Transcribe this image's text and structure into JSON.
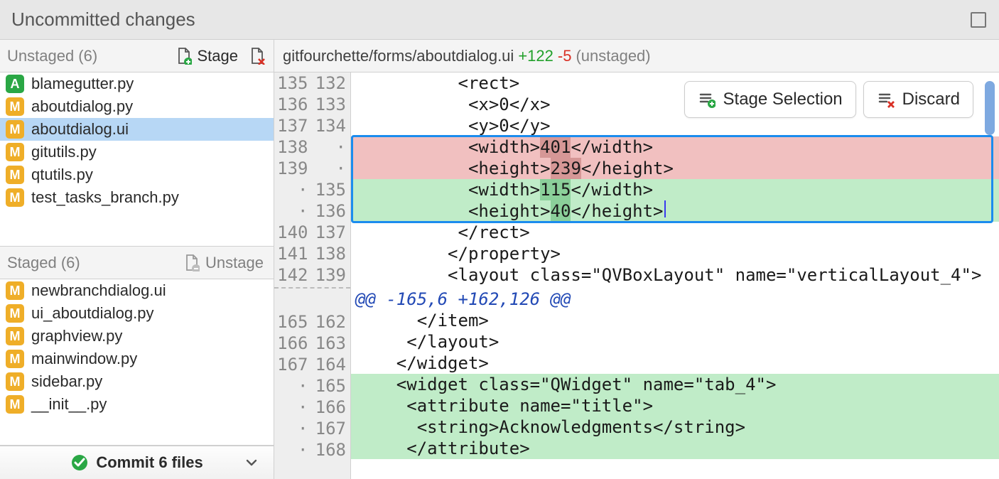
{
  "header": {
    "title": "Uncommitted changes"
  },
  "sidebar": {
    "unstaged": {
      "title": "Unstaged (6)",
      "stage_label": "Stage",
      "items": [
        {
          "status": "A",
          "name": "blamegutter.py",
          "selected": false
        },
        {
          "status": "M",
          "name": "aboutdialog.py",
          "selected": false
        },
        {
          "status": "M",
          "name": "aboutdialog.ui",
          "selected": true
        },
        {
          "status": "M",
          "name": "gitutils.py",
          "selected": false
        },
        {
          "status": "M",
          "name": "qtutils.py",
          "selected": false
        },
        {
          "status": "M",
          "name": "test_tasks_branch.py",
          "selected": false
        }
      ]
    },
    "staged": {
      "title": "Staged (6)",
      "unstage_label": "Unstage",
      "items": [
        {
          "status": "M",
          "name": "newbranchdialog.ui"
        },
        {
          "status": "M",
          "name": "ui_aboutdialog.py"
        },
        {
          "status": "M",
          "name": "graphview.py"
        },
        {
          "status": "M",
          "name": "mainwindow.py"
        },
        {
          "status": "M",
          "name": "sidebar.py"
        },
        {
          "status": "M",
          "name": "__init__.py"
        }
      ]
    },
    "commit_label": "Commit 6 files"
  },
  "diff": {
    "path": "gitfourchette/forms/aboutdialog.ui",
    "additions": "+122",
    "deletions": "-5",
    "state": "(unstaged)",
    "actions": {
      "stage_selection": "Stage Selection",
      "discard": "Discard"
    },
    "lines": [
      {
        "old": "135",
        "new": "132",
        "type": "ctx",
        "text": "          <rect>"
      },
      {
        "old": "136",
        "new": "133",
        "type": "ctx",
        "text": "           <x>0</x>"
      },
      {
        "old": "137",
        "new": "134",
        "type": "ctx",
        "text": "           <y>0</y>"
      },
      {
        "old": "138",
        "new": "·",
        "type": "del",
        "text_before": "           <width>",
        "intra": "401",
        "text_after": "</width>"
      },
      {
        "old": "139",
        "new": "·",
        "type": "del",
        "text_before": "           <height>",
        "intra": "239",
        "text_after": "</height>"
      },
      {
        "old": "·",
        "new": "135",
        "type": "add",
        "text_before": "           <width>",
        "intra": "115",
        "text_after": "</width>"
      },
      {
        "old": "·",
        "new": "136",
        "type": "add",
        "text_before": "           <height>",
        "intra": "40",
        "text_after": "</height>",
        "cursor": true
      },
      {
        "old": "140",
        "new": "137",
        "type": "ctx",
        "text": "          </rect>"
      },
      {
        "old": "141",
        "new": "138",
        "type": "ctx",
        "text": "         </property>"
      },
      {
        "old": "142",
        "new": "139",
        "type": "ctx",
        "text": "         <layout class=\"QVBoxLayout\" name=\"verticalLayout_4\">"
      },
      {
        "type": "hunksep"
      },
      {
        "old": "",
        "new": "",
        "type": "hunk",
        "text": "@@ -165,6 +162,126 @@"
      },
      {
        "old": "165",
        "new": "162",
        "type": "ctx",
        "text": "      </item>"
      },
      {
        "old": "166",
        "new": "163",
        "type": "ctx",
        "text": "     </layout>"
      },
      {
        "old": "167",
        "new": "164",
        "type": "ctx",
        "text": "    </widget>"
      },
      {
        "old": "·",
        "new": "165",
        "type": "add",
        "text": "    <widget class=\"QWidget\" name=\"tab_4\">"
      },
      {
        "old": "·",
        "new": "166",
        "type": "add",
        "text": "     <attribute name=\"title\">"
      },
      {
        "old": "·",
        "new": "167",
        "type": "add",
        "text": "      <string>Acknowledgments</string>"
      },
      {
        "old": "·",
        "new": "168",
        "type": "add",
        "text": "     </attribute>"
      }
    ],
    "selection": {
      "start_index": 3,
      "end_index": 6
    }
  }
}
